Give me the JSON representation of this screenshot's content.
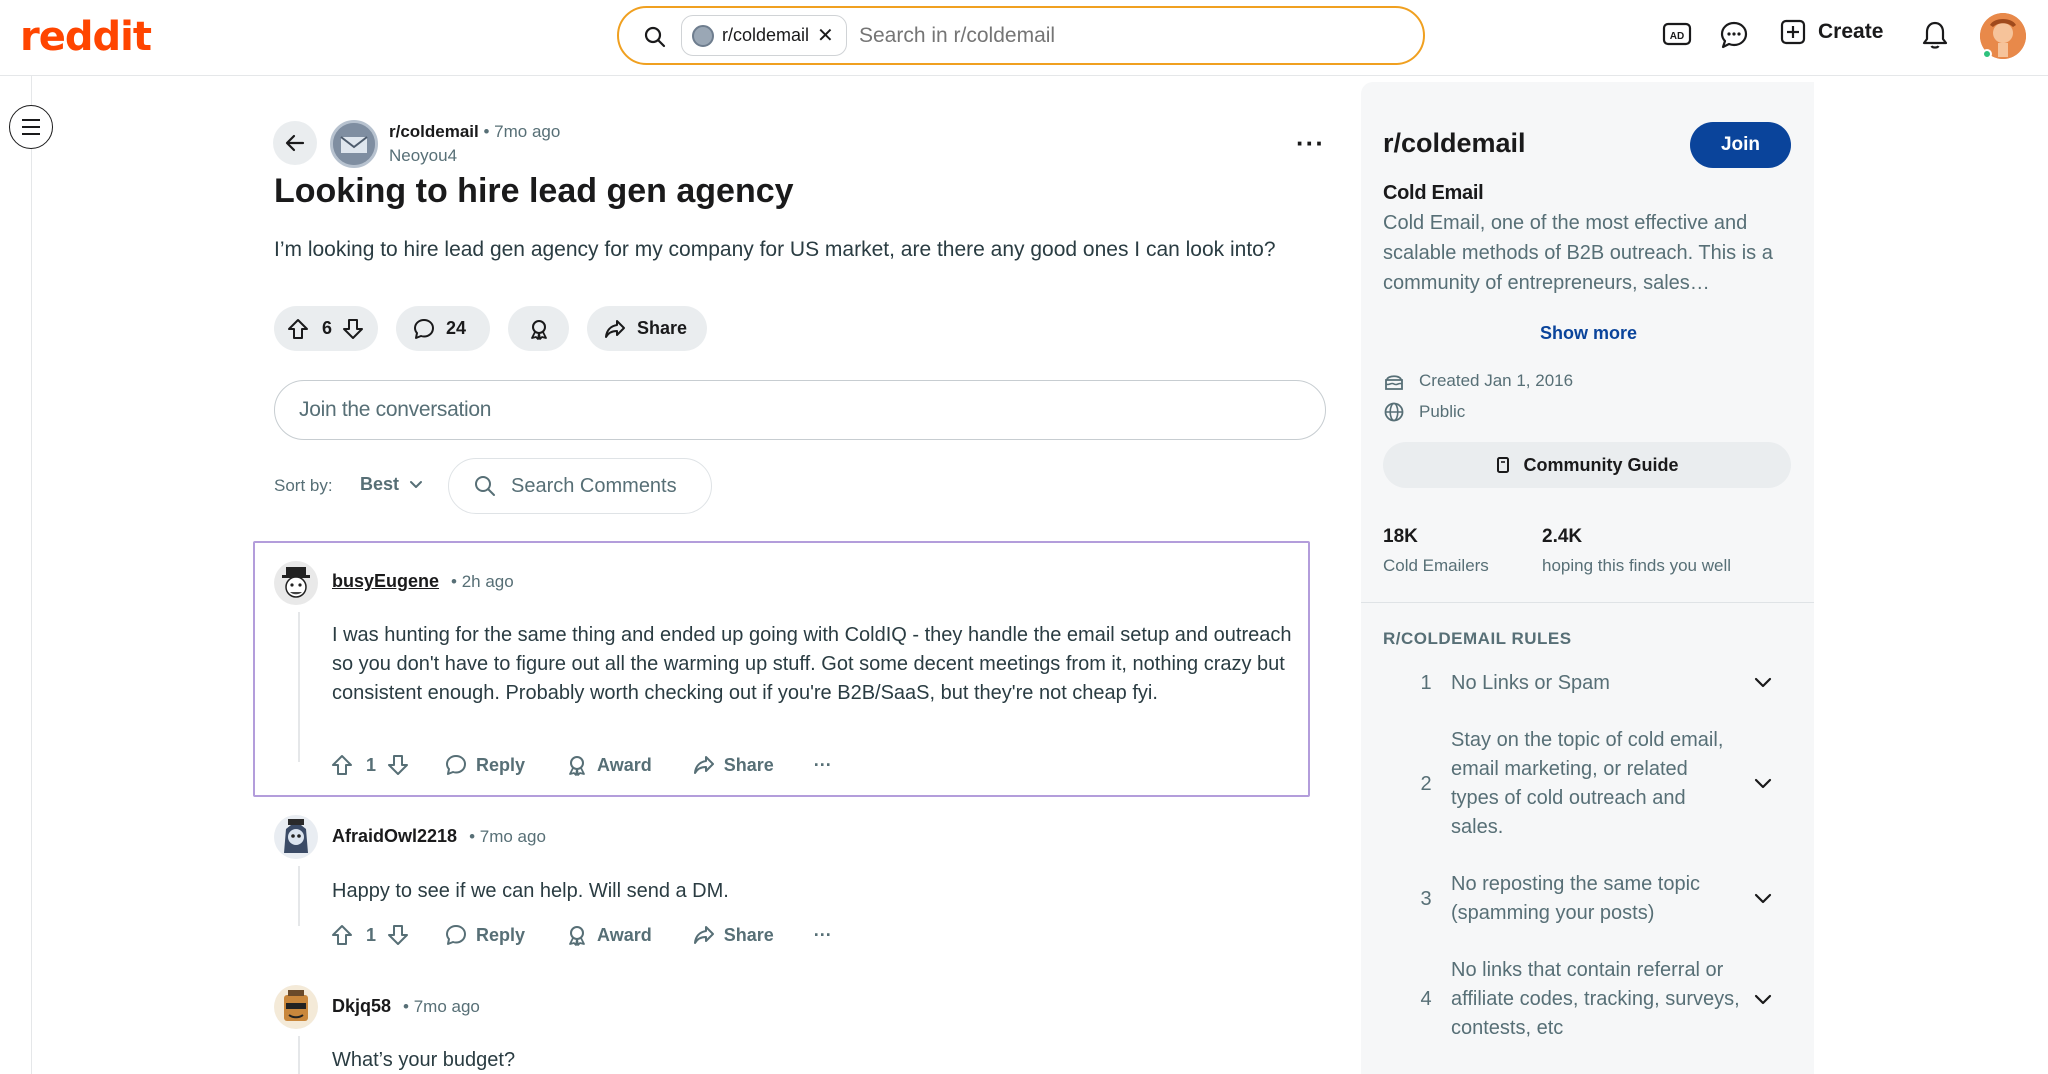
{
  "header": {
    "logo": "reddit",
    "search_chip": "r/coldemail",
    "search_placeholder": "Search in r/coldemail",
    "create_label": "Create"
  },
  "post": {
    "subreddit": "r/coldemail",
    "time": "• 7mo ago",
    "author": "Neoyou4",
    "title": "Looking to hire lead gen agency",
    "body": "I’m looking to hire lead gen agency for my company for US market, are there any good ones I can look into?",
    "votes": "6",
    "comments": "24",
    "share_label": "Share"
  },
  "conversation": {
    "placeholder": "Join the conversation",
    "sort_label": "Sort by:",
    "sort_value": "Best",
    "search_comments": "Search Comments"
  },
  "comments": [
    {
      "user": "busyEugene",
      "time": "• 2h ago",
      "text": "I was hunting for the same thing and ended up going with ColdIQ - they handle the email setup and outreach so you don't have to figure out all the warming up stuff. Got some decent meetings from it, nothing crazy but consistent enough. Probably worth checking out if you're B2B/SaaS, but they're not cheap fyi.",
      "votes": "1"
    },
    {
      "user": "AfraidOwl2218",
      "time": "• 7mo ago",
      "text": "Happy to see if we can help. Will send a DM.",
      "votes": "1"
    },
    {
      "user": "Dkjq58",
      "time": "• 7mo ago",
      "text": "What’s your budget?"
    }
  ],
  "actions": {
    "reply": "Reply",
    "award": "Award",
    "share": "Share",
    "more": "···"
  },
  "sidebar": {
    "title": "r/coldemail",
    "join_label": "Join",
    "subtitle": "Cold Email",
    "description": "Cold Email, one of the most effective and scalable methods of B2B outreach. This is a community of entrepreneurs, sales…",
    "show_more": "Show more",
    "created": "Created Jan 1, 2016",
    "visibility": "Public",
    "guide_label": "Community Guide",
    "stats": [
      {
        "value": "18K",
        "label": "Cold Emailers"
      },
      {
        "value": "2.4K",
        "label": "hoping this finds you well"
      }
    ],
    "rules_heading": "R/COLDEMAIL RULES",
    "rules": [
      {
        "num": "1",
        "text": "No Links or Spam"
      },
      {
        "num": "2",
        "text": "Stay on the topic of cold email, email marketing, or related types of cold outreach and sales."
      },
      {
        "num": "3",
        "text": "No reposting the same topic (spamming your posts)"
      },
      {
        "num": "4",
        "text": "No links that contain referral or affiliate codes, tracking, surveys, contests, etc"
      }
    ]
  },
  "colors": {
    "brand": "#ff4500",
    "join_button": "#0a449b",
    "search_border": "#f0a020",
    "highlight_border": "#b39ddb"
  }
}
